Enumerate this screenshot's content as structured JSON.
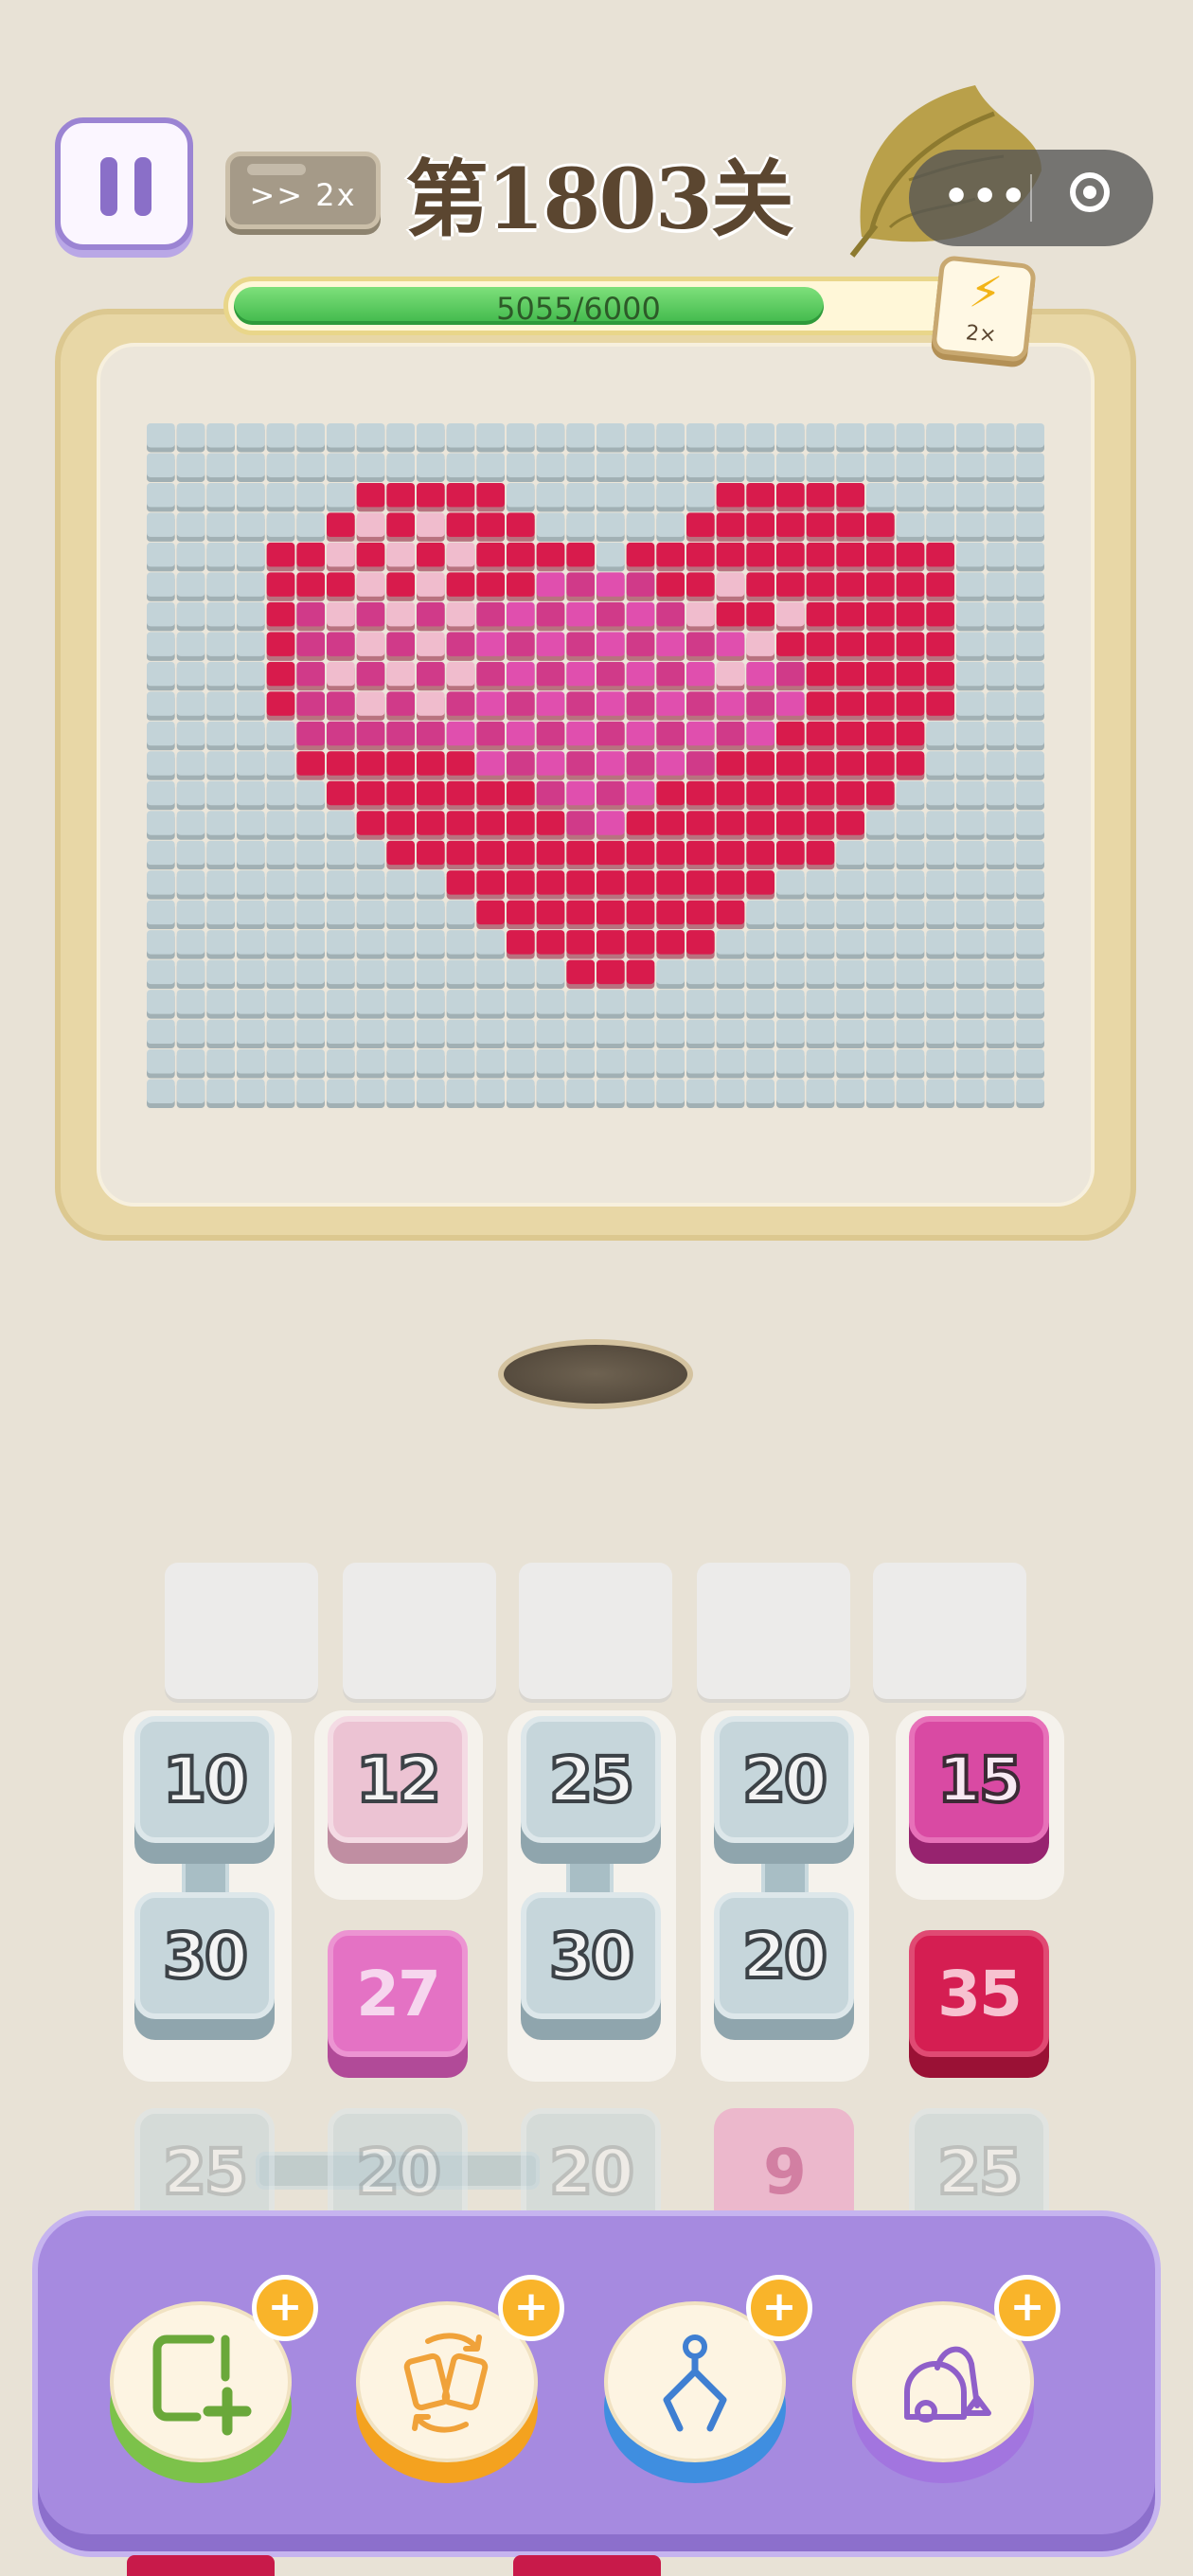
{
  "header": {
    "pause_icon": "pause-icon",
    "speed_label": ">>  2x",
    "level_title": "第1803关"
  },
  "capsule": {
    "more_icon": "more-dots-icon",
    "close_icon": "target-circle-icon"
  },
  "progress": {
    "text": "5055/6000",
    "current": 5055,
    "max": 6000
  },
  "booster": {
    "icon": "lightning-bolt-icon",
    "label": "2×"
  },
  "picture": {
    "subject": "pixel heart",
    "rows": 23,
    "cols": 30,
    "colors": {
      "empty": "#c3d3d8",
      "red": "#d81b4c",
      "hotpink": "#e04fae",
      "lightpink": "#f0bccd",
      "rose": "#d03a89"
    }
  },
  "slots": {
    "count": 5
  },
  "tiles": {
    "row1": [
      "10",
      "12",
      "25",
      "20",
      "15"
    ],
    "row2": [
      "30",
      "27",
      "30",
      "20",
      "35"
    ],
    "row3": [
      "25",
      "20",
      "20",
      "9",
      "25"
    ]
  },
  "tools": [
    {
      "name": "add-slot",
      "icon": "add-square-icon",
      "base_color": "#7cc24a",
      "plus": "+"
    },
    {
      "name": "shuffle",
      "icon": "shuffle-cards-icon",
      "base_color": "#f4a21f",
      "plus": "+"
    },
    {
      "name": "grab",
      "icon": "claw-grabber-icon",
      "base_color": "#3f8ee0",
      "plus": "+"
    },
    {
      "name": "vacuum",
      "icon": "vacuum-cleaner-icon",
      "base_color": "#a275df",
      "plus": "+"
    }
  ]
}
